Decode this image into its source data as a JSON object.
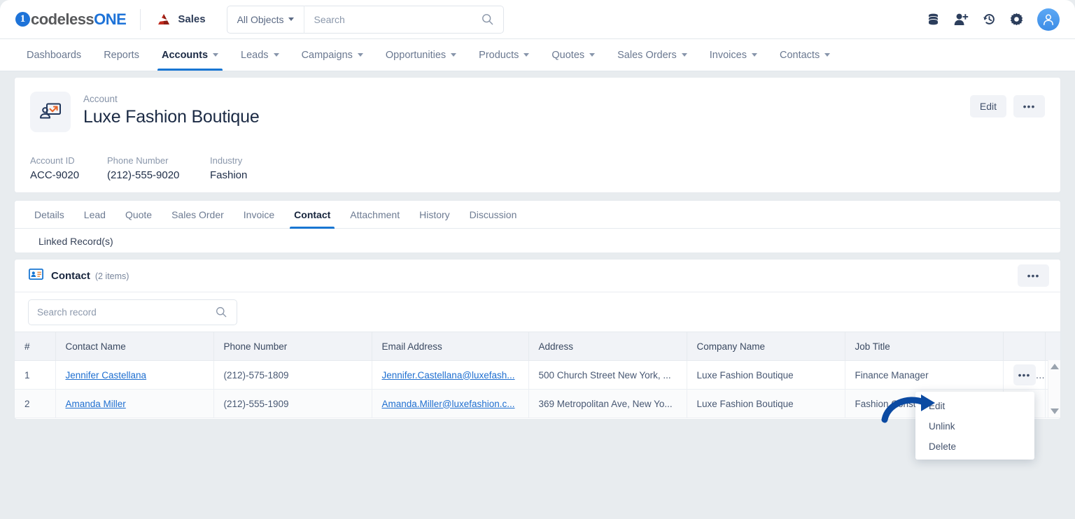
{
  "topbar": {
    "logo": {
      "mark": "1",
      "text_a": "codeless",
      "text_b": "ONE",
      "icon": "codelessone-logo"
    },
    "app_switcher": {
      "label": "Sales",
      "icon": "sales-app-icon"
    },
    "search": {
      "object_filter": "All Objects",
      "placeholder": "Search",
      "value": "",
      "icon": "search-icon"
    },
    "icons": [
      {
        "name": "database-icon",
        "label": "Data"
      },
      {
        "name": "add-user-icon",
        "label": "Add User"
      },
      {
        "name": "history-icon",
        "label": "Recent"
      },
      {
        "name": "gear-icon",
        "label": "Settings"
      }
    ],
    "avatar": {
      "name": "user-avatar",
      "label": ""
    }
  },
  "mainnav": {
    "items": [
      {
        "label": "Dashboards",
        "has_caret": false,
        "active": false
      },
      {
        "label": "Reports",
        "has_caret": false,
        "active": false
      },
      {
        "label": "Accounts",
        "has_caret": true,
        "active": true
      },
      {
        "label": "Leads",
        "has_caret": true,
        "active": false
      },
      {
        "label": "Campaigns",
        "has_caret": true,
        "active": false
      },
      {
        "label": "Opportunities",
        "has_caret": true,
        "active": false
      },
      {
        "label": "Products",
        "has_caret": true,
        "active": false
      },
      {
        "label": "Quotes",
        "has_caret": true,
        "active": false
      },
      {
        "label": "Sales Orders",
        "has_caret": true,
        "active": false
      },
      {
        "label": "Invoices",
        "has_caret": true,
        "active": false
      },
      {
        "label": "Contacts",
        "has_caret": true,
        "active": false
      }
    ]
  },
  "record_header": {
    "kind": "Account",
    "name": "Luxe Fashion Boutique",
    "icon": "account-presentation-icon",
    "edit_label": "Edit",
    "more_label": "•••",
    "fields": [
      {
        "label": "Account ID",
        "value": "ACC-9020"
      },
      {
        "label": "Phone Number",
        "value": "(212)-555-9020"
      },
      {
        "label": "Industry",
        "value": "Fashion"
      }
    ]
  },
  "record_tabs": {
    "items": [
      {
        "label": "Details",
        "active": false
      },
      {
        "label": "Lead",
        "active": false
      },
      {
        "label": "Quote",
        "active": false
      },
      {
        "label": "Sales Order",
        "active": false
      },
      {
        "label": "Invoice",
        "active": false
      },
      {
        "label": "Contact",
        "active": true
      },
      {
        "label": "Attachment",
        "active": false
      },
      {
        "label": "History",
        "active": false
      },
      {
        "label": "Discussion",
        "active": false
      }
    ],
    "linked_records_label": "Linked Record(s)"
  },
  "contact_panel": {
    "icon": "contact-card-icon",
    "title": "Contact",
    "count_label": "(2 items)",
    "more_label": "•••",
    "search": {
      "placeholder": "Search record",
      "value": "",
      "icon": "search-icon"
    },
    "columns": [
      "#",
      "Contact Name",
      "Phone Number",
      "Email Address",
      "Address",
      "Company Name",
      "Job Title"
    ],
    "rows": [
      {
        "index": "1",
        "contact_name": "Jennifer Castellana",
        "phone_number": "(212)-575-1809",
        "email_address": "Jennifer.Castellana@luxefash...",
        "address": "500 Church Street New York, ...",
        "company_name": "Luxe Fashion Boutique",
        "job_title": "Finance Manager",
        "row_menu_label": "•••"
      },
      {
        "index": "2",
        "contact_name": "Amanda Miller",
        "phone_number": "(212)-555-1909",
        "email_address": "Amanda.Miller@luxefashion.c...",
        "address": "369 Metropolitan Ave, New Yo...",
        "company_name": "Luxe Fashion Boutique",
        "job_title": "Fashion Consultant",
        "row_menu_label": "•••"
      }
    ],
    "scrollbar": {
      "up_icon": "scroll-up-arrow-icon",
      "down_icon": "scroll-down-arrow-icon"
    }
  },
  "context_menu": {
    "items": [
      {
        "label": "Edit"
      },
      {
        "label": "Unlink"
      },
      {
        "label": "Delete"
      }
    ]
  },
  "annotation": {
    "arrow": "blue-curved-arrow",
    "points_to": "Edit"
  },
  "colors": {
    "accent": "#1976d2",
    "link": "#1f6fd0",
    "page_bg": "#e8ecef",
    "card_bg": "#ffffff",
    "header_text": "#1b2a44",
    "muted_text": "#8693a8",
    "annotation": "#0b4aa2"
  }
}
